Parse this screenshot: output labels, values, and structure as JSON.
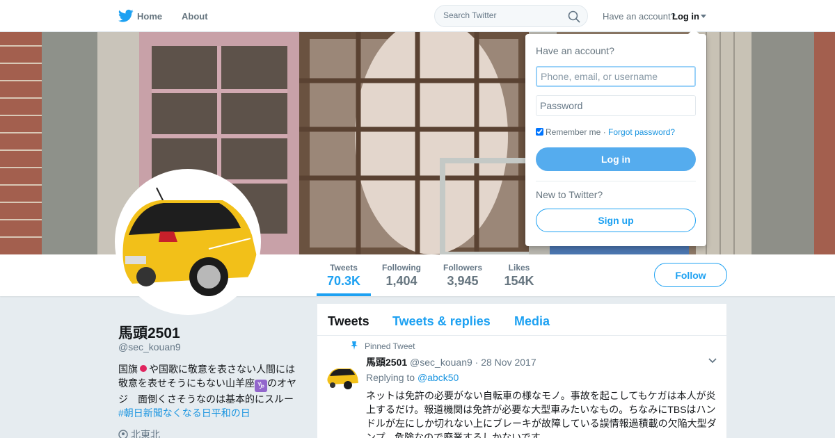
{
  "nav": {
    "home_label": "Home",
    "about_label": "About",
    "search_placeholder": "Search Twitter",
    "account_prompt": "Have an account?",
    "login_label": "Log in"
  },
  "stats": [
    {
      "label": "Tweets",
      "value": "70.3K"
    },
    {
      "label": "Following",
      "value": "1,404"
    },
    {
      "label": "Followers",
      "value": "3,945"
    },
    {
      "label": "Likes",
      "value": "154K"
    }
  ],
  "follow_label": "Follow",
  "profile": {
    "name": "馬頭2501",
    "handle": "@sec_kouan9",
    "bio_1": "国旗",
    "bio_2": "や国歌に敬意を表さない人間には敬意を表せそうにもない山羊座",
    "bio_zodiac": "♑",
    "bio_3": "のオヤジ　面倒くさそうなのは基本的にスルー　",
    "bio_hashtag": "#朝日新聞なくなる日平和の日",
    "location": "北東北"
  },
  "tabs": [
    "Tweets",
    "Tweets & replies",
    "Media"
  ],
  "tweet": {
    "pinned_label": "Pinned Tweet",
    "name": "馬頭2501",
    "handle": "@sec_kouan9",
    "separator": "·",
    "date": "28 Nov 2017",
    "replying_label": "Replying to",
    "reply_handle": "@abck50",
    "text": "ネットは免許の必要がない自転車の様なモノ。事故を起こしてもケガは本人が炎上するだけ。報道機関は免許が必要な大型車みたいなもの。ちなみにTBSはハンドルが左にしか切れない上にブレーキが故障している誤情報過積載の欠陥大型ダンプ。危険なので廃業するしかないです。"
  },
  "login_dropdown": {
    "title": "Have an account?",
    "username_placeholder": "Phone, email, or username",
    "password_placeholder": "Password",
    "remember_label": "Remember me",
    "dot": "·",
    "forgot_label": "Forgot password?",
    "login_button": "Log in",
    "new_label": "New to Twitter?",
    "signup_button": "Sign up"
  },
  "colors": {
    "accent": "#1da1f2",
    "login_button": "#55acee",
    "background": "#e6ecf0"
  }
}
